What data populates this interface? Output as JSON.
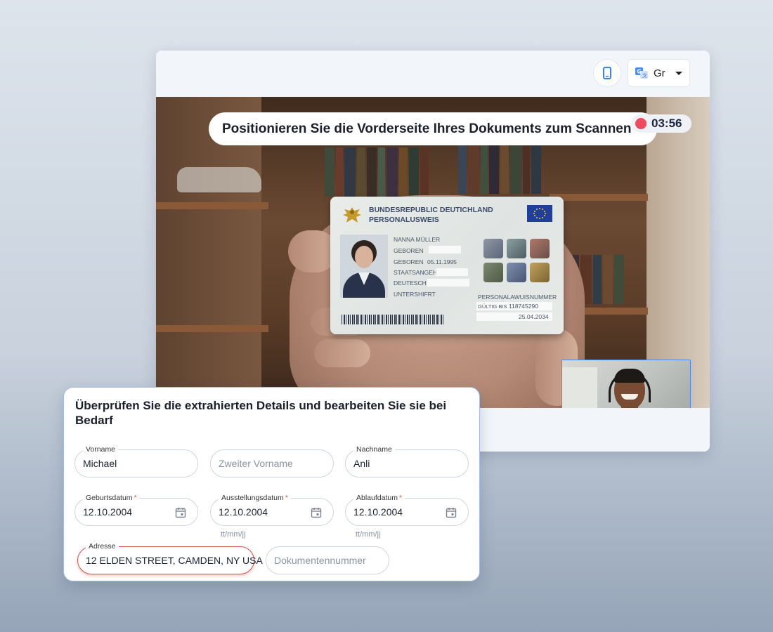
{
  "toolbar": {
    "device_icon": "smartphone-icon",
    "language_icon": "translate-icon",
    "language_label": "Gr"
  },
  "camera": {
    "prompt": "Positionieren Sie die Vorderseite Ihres Dokuments zum Scannen",
    "timer": "03:56",
    "rec_color": "#f04a5e"
  },
  "id_card": {
    "title_line1": "BUNDESREPUBLIC DEUTICHLAND",
    "title_line2": "PERSONALUSWEIS",
    "name": "NANNA MÜLLER",
    "born_label": "GEBOREN",
    "born_date_label": "GEBOREN",
    "born_date": "05.11.1995",
    "nationality_label": "STAATSANGEH",
    "nationality": "DEUTESCH",
    "signature_label": "UNTERSHIFRT",
    "number_label": "PERSONALAWUISNUMMER",
    "valid_label": "GÜLTIG BIS",
    "number": "118745290",
    "valid_date": "25.04.2034"
  },
  "form": {
    "title": "Überprüfen Sie die extrahierten Details und bearbeiten Sie sie bei Bedarf",
    "first_name": {
      "label": "Vorname",
      "value": "Michael"
    },
    "middle_name": {
      "placeholder": "Zweiter Vorname"
    },
    "last_name": {
      "label": "Nachname",
      "value": "Anli"
    },
    "birth_date": {
      "label": "Geburtsdatum",
      "required": "*",
      "value": "12.10.2004"
    },
    "issue_date": {
      "label": "Ausstellungsdatum",
      "required": "*",
      "value": "12.10.2004",
      "hint": "tt/mm/jj"
    },
    "expiry_date": {
      "label": "Ablaufdatum",
      "required": "*",
      "value": "12.10.2004",
      "hint": "tt/mm/jj"
    },
    "address": {
      "label": "Adresse",
      "value": "12 ELDEN STREET, CAMDEN, NY USA"
    },
    "document_number": {
      "placeholder": "Dokumentennummer"
    },
    "error_color": "#d9534f",
    "accent_color": "#4c8cf0"
  }
}
